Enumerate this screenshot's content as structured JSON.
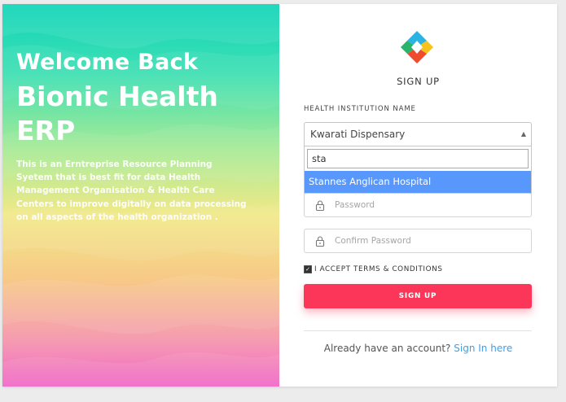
{
  "hero": {
    "welcome": "Welcome Back",
    "app_name_line1": "Bionic Health",
    "app_name_line2": "ERP",
    "description": "This is an Erntreprise Resource Planning Syetem that is best fit for data Health Management Organisation & Health Care Centers to improve digitally on data processing on all aspects of the health organization ."
  },
  "form": {
    "title": "SIGN UP",
    "institution_label": "HEALTH INSTITUTION NAME",
    "institution_selected": "Kwarati Dispensary",
    "search_value": "sta",
    "highlighted_option": "Stannes Anglican Hospital",
    "password_placeholder": "Password",
    "confirm_placeholder": "Confirm Password",
    "terms_label": "I ACCEPT TERMS & CONDITIONS",
    "terms_checked": true,
    "signup_button": "SIGN UP",
    "already_text": "Already have an account?",
    "signin_link": "Sign In here"
  },
  "icons": {
    "select_arrow": "triangle-up-icon",
    "lock": "lock-icon",
    "checkbox": "checkmark-icon",
    "logo": "diamond-logo-icon"
  },
  "colors": {
    "accent": "#fb3659",
    "link": "#3aa1e8",
    "highlight": "#5897fb"
  }
}
